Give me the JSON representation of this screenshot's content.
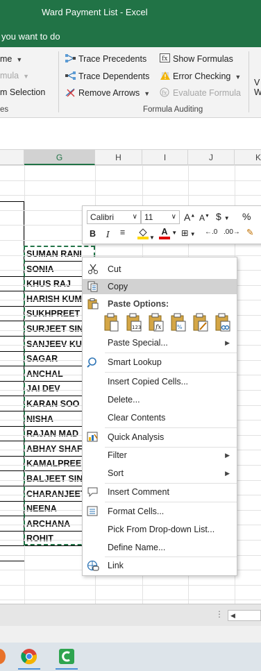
{
  "window": {
    "title": "Ward Payment List  -  Excel",
    "tell_me": "you want to do"
  },
  "ribbon": {
    "left_partial": [
      {
        "label": "me",
        "dropdown": true,
        "disabled": false
      },
      {
        "label": "mula",
        "dropdown": true,
        "disabled": true
      },
      {
        "label": "m Selection",
        "dropdown": false,
        "disabled": false
      }
    ],
    "left_group_label": "es",
    "formula_auditing": {
      "trace_precedents": "Trace Precedents",
      "trace_dependents": "Trace Dependents",
      "remove_arrows": "Remove Arrows",
      "show_formulas": "Show Formulas",
      "error_checking": "Error Checking",
      "evaluate_formula": "Evaluate Formula",
      "group_label": "Formula Auditing"
    },
    "right_partial": [
      "V",
      "W"
    ]
  },
  "columns": {
    "g": "G",
    "h": "H",
    "i": "I",
    "j": "J",
    "k": "K"
  },
  "cells": [
    "SUMAN RANI",
    "SONIA",
    "KHUS RAJ",
    "HARISH KUM",
    "SUKHPREET S",
    "SURJEET SIN",
    "SANJEEV KU",
    "SAGAR",
    "ANCHAL",
    "JAI DEV",
    "KARAN SOO",
    "NISHA",
    "RAJAN MAD",
    "ABHAY SHAF",
    "KAMALPREE",
    "BALJEET SIN",
    "CHARANJEET",
    "NEENA",
    "ARCHANA",
    "ROHIT"
  ],
  "mini_toolbar": {
    "font": "Calibri",
    "size": "11",
    "grow": "A",
    "shrink": "A",
    "currency": "$",
    "percent": "%",
    "bold": "B",
    "italic": "I",
    "font_color_letter": "A",
    "colors": {
      "highlight": "#ffd700",
      "font_color": "#e00000"
    }
  },
  "context_menu": {
    "cut": "Cut",
    "copy": "Copy",
    "paste_options": "Paste Options:",
    "paste_special": "Paste Special...",
    "smart_lookup": "Smart Lookup",
    "insert_copied": "Insert Copied Cells...",
    "delete": "Delete...",
    "clear_contents": "Clear Contents",
    "quick_analysis": "Quick Analysis",
    "filter": "Filter",
    "sort": "Sort",
    "insert_comment": "Insert Comment",
    "format_cells": "Format Cells...",
    "pick_list": "Pick From Drop-down List...",
    "define_name": "Define Name...",
    "link": "Link"
  },
  "colors": {
    "excel_green": "#217346",
    "highlight": "#d2d2d2"
  }
}
